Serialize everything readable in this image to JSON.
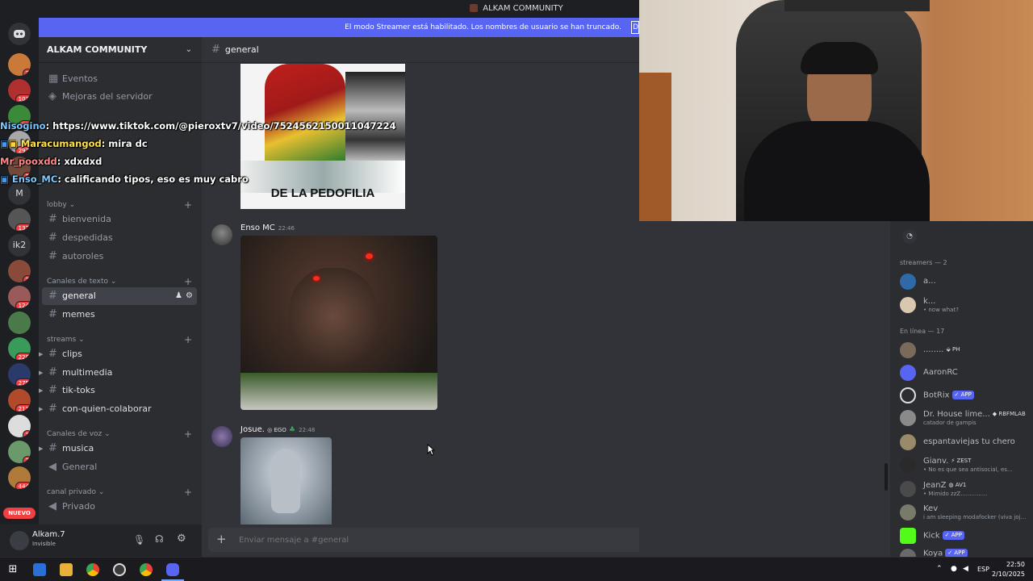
{
  "window": {
    "title": "ALKAM COMMUNITY"
  },
  "banner": {
    "text": "El modo Streamer está habilitado. Los nombres de usuario se han truncado.",
    "button": "D"
  },
  "servers": [
    {
      "badge": "3"
    },
    {
      "badge": "103"
    },
    {
      "badge": "71"
    },
    {
      "badge": "297"
    },
    {
      "badge": "2"
    },
    {
      "label": "M"
    },
    {
      "badge": "132"
    },
    {
      "label": "ik2"
    },
    {
      "badge": "2"
    },
    {
      "badge": "124"
    },
    {
      "badge": ""
    },
    {
      "badge": "228"
    },
    {
      "badge": "275"
    },
    {
      "badge": "211"
    },
    {
      "badge": "1"
    },
    {
      "badge": "2"
    },
    {
      "badge": "444"
    }
  ],
  "servers_new_label": "NUEVO",
  "sidebar": {
    "server_name": "ALKAM COMMUNITY",
    "top_items": [
      "Eventos",
      "Mejoras del servidor"
    ],
    "categories": [
      {
        "name": "lobby",
        "channels": [
          "bienvenida",
          "despedidas",
          "autoroles"
        ]
      },
      {
        "name": "Canales de texto",
        "channels": [
          "general",
          "memes"
        ]
      },
      {
        "name": "streams",
        "channels": [
          "clips",
          "multimedia",
          "tik-toks",
          "con-quien-colaborar"
        ]
      },
      {
        "name": "Canales de voz",
        "channels": [
          "musica",
          "General"
        ]
      },
      {
        "name": "canal privado",
        "channels": [
          "Privado"
        ]
      }
    ]
  },
  "overlay_chat": [
    {
      "user": "Nisogino",
      "text": ": https://www.tiktok.com/@piero­xtv7/video/7524562150011047224",
      "color": "#7ec8ff"
    },
    {
      "user": "Maracumangod",
      "text": ": mira dc",
      "color": "#ffe14a"
    },
    {
      "user": "Mr_pooxdd",
      "text": ": xdxdxd",
      "color": "#ff7a7a"
    },
    {
      "user": "Enso_MC",
      "text": ": calificando tipos, eso es muy cabro",
      "color": "#7ec8ff"
    }
  ],
  "chat": {
    "channel": "general",
    "meme_caption": "DE LA PEDOFILIA",
    "messages": [
      {
        "author": "Enso MC",
        "time": "22:46"
      },
      {
        "author": "Josue.",
        "badge": "EGO",
        "time": "22:48"
      }
    ],
    "composer_placeholder": "Enviar mensaje a #general"
  },
  "user": {
    "name": "Alkam.7",
    "status": "Invisible"
  },
  "members": {
    "groups": [
      {
        "name": "streamers — 2",
        "members": [
          {
            "name": "a...",
            "status": ""
          },
          {
            "name": "k...",
            "status": "• now what?"
          }
        ]
      },
      {
        "name": "En línea — 17",
        "members": [
          {
            "name": "........",
            "tag": "PH",
            "status": ""
          },
          {
            "name": "AaronRC",
            "status": ""
          },
          {
            "name": "BotRix",
            "app": "APP",
            "status": ""
          },
          {
            "name": "Dr. House lime...",
            "tag": "RBFMLAB",
            "status": "catador de gampis"
          },
          {
            "name": "espantaviejas tu chero",
            "status": ""
          },
          {
            "name": "Gianv.",
            "tag": "ZEST",
            "status": "• No es que sea antisocial, es..."
          },
          {
            "name": "JeanZ",
            "tag": "AV1",
            "status": "• Mimido zzZ..............."
          },
          {
            "name": "Kev",
            "status": "i am sleeping modafocker (viva joj..."
          },
          {
            "name": "Kick",
            "app": "APP",
            "status": ""
          },
          {
            "name": "Koya",
            "app": "APP",
            "status": ""
          }
        ]
      }
    ]
  },
  "taskbar": {
    "lang": "ESP",
    "time": "22:50",
    "date": "2/10/2025"
  },
  "colors": {
    "blurple": "#5865f2",
    "bg": "#313338",
    "sidebar": "#2b2d31"
  }
}
